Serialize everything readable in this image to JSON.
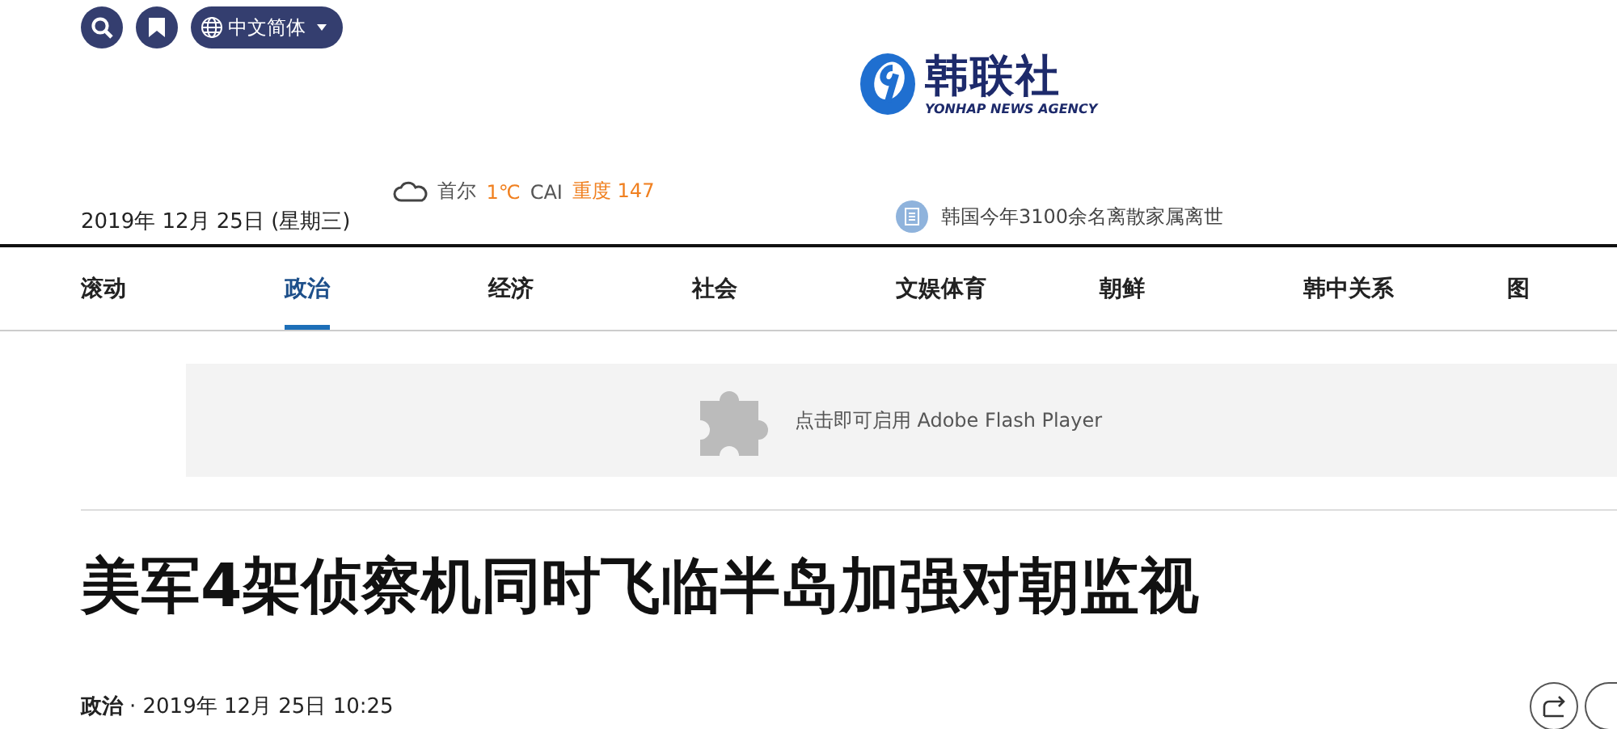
{
  "top_bar": {
    "language": "中文简体"
  },
  "logo": {
    "name": "韩联社",
    "subtitle": "YONHAP NEWS AGENCY"
  },
  "date": "2019年 12月 25日 (星期三)",
  "weather": {
    "city": "首尔",
    "temperature": "1℃",
    "index_label": "CAI",
    "index_value": "重度 147"
  },
  "headline_ticker": "韩国今年3100余名离散家属离世",
  "nav": [
    {
      "label": "滚动",
      "selected": false
    },
    {
      "label": "政治",
      "selected": true
    },
    {
      "label": "经济",
      "selected": false
    },
    {
      "label": "社会",
      "selected": false
    },
    {
      "label": "文娱体育",
      "selected": false
    },
    {
      "label": "朝鲜",
      "selected": false
    },
    {
      "label": "韩中关系",
      "selected": false
    },
    {
      "label": "图",
      "selected": false
    }
  ],
  "plugin_notice": "点击即可启用 Adobe Flash Player",
  "article": {
    "title": "美军4架侦察机同时飞临半岛加强对朝监视",
    "section": "政治",
    "timestamp": "· 2019年 12月 25日 10:25"
  }
}
